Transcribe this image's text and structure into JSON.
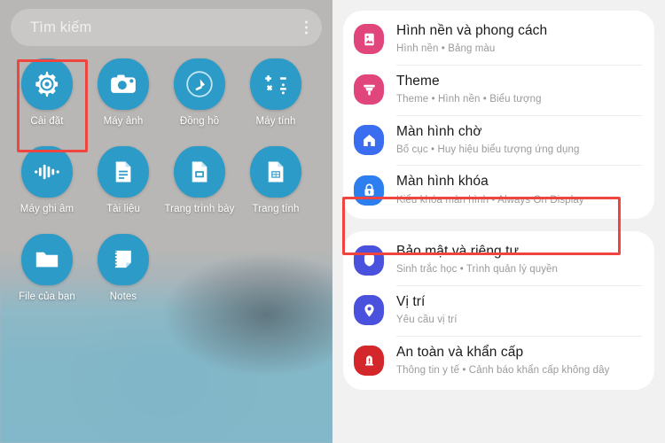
{
  "home": {
    "search": {
      "placeholder": "Tìm kiếm",
      "menu_icon": "kebab-menu-icon"
    },
    "icon_color": "#2d9bc7",
    "highlight_color": "#f0453f",
    "apps": [
      [
        {
          "label": "Cài đặt",
          "icon": "settings-gear-icon",
          "highlighted": true
        },
        {
          "label": "Máy ảnh",
          "icon": "camera-icon",
          "highlighted": false
        },
        {
          "label": "Đồng hồ",
          "icon": "clock-icon",
          "highlighted": false
        },
        {
          "label": "Máy tính",
          "icon": "calculator-icon",
          "highlighted": false
        }
      ],
      [
        {
          "label": "Máy ghi âm",
          "icon": "voice-recorder-icon",
          "highlighted": false
        },
        {
          "label": "Tài liệu",
          "icon": "document-icon",
          "highlighted": false
        },
        {
          "label": "Trang trình bày",
          "icon": "slides-icon",
          "highlighted": false
        },
        {
          "label": "Trang tính",
          "icon": "spreadsheet-icon",
          "highlighted": false
        }
      ],
      [
        {
          "label": "File của bạn",
          "icon": "folder-icon",
          "highlighted": false
        },
        {
          "label": "Notes",
          "icon": "notes-icon",
          "highlighted": false
        }
      ]
    ]
  },
  "settings": {
    "highlight_color": "#f0453f",
    "groups": [
      {
        "items": [
          {
            "title": "Hình nền và phong cách",
            "subtitle": "Hình nền  •  Bảng màu",
            "icon": "wallpaper-image-icon",
            "icon_color": "#e0457b",
            "highlighted": false
          },
          {
            "title": "Theme",
            "subtitle": "Theme  •  Hình nền  •  Biểu tượng",
            "icon": "paintbrush-icon",
            "icon_color": "#e0457b",
            "highlighted": false
          },
          {
            "title": "Màn hình chờ",
            "subtitle": "Bố cục  •  Huy hiệu biểu tượng ứng dụng",
            "icon": "home-icon",
            "icon_color": "#3a6df0",
            "highlighted": false
          },
          {
            "title": "Màn hình khóa",
            "subtitle": "Kiểu khóa màn hình  •  Always On Display",
            "icon": "lock-icon",
            "icon_color": "#2d7ff0",
            "highlighted": true
          }
        ]
      },
      {
        "items": [
          {
            "title": "Bảo mật và riêng tư",
            "subtitle": "Sinh trắc học  •  Trình quản lý quyền",
            "icon": "shield-icon",
            "icon_color": "#4a52dd",
            "highlighted": false
          },
          {
            "title": "Vị trí",
            "subtitle": "Yêu cầu vị trí",
            "icon": "location-pin-icon",
            "icon_color": "#4a52dd",
            "highlighted": false
          },
          {
            "title": "An toàn và khẩn cấp",
            "subtitle": "Thông tin y tế  •  Cảnh báo khẩn cấp không dây",
            "icon": "emergency-alert-icon",
            "icon_color": "#d4272c",
            "highlighted": false
          }
        ]
      }
    ]
  }
}
